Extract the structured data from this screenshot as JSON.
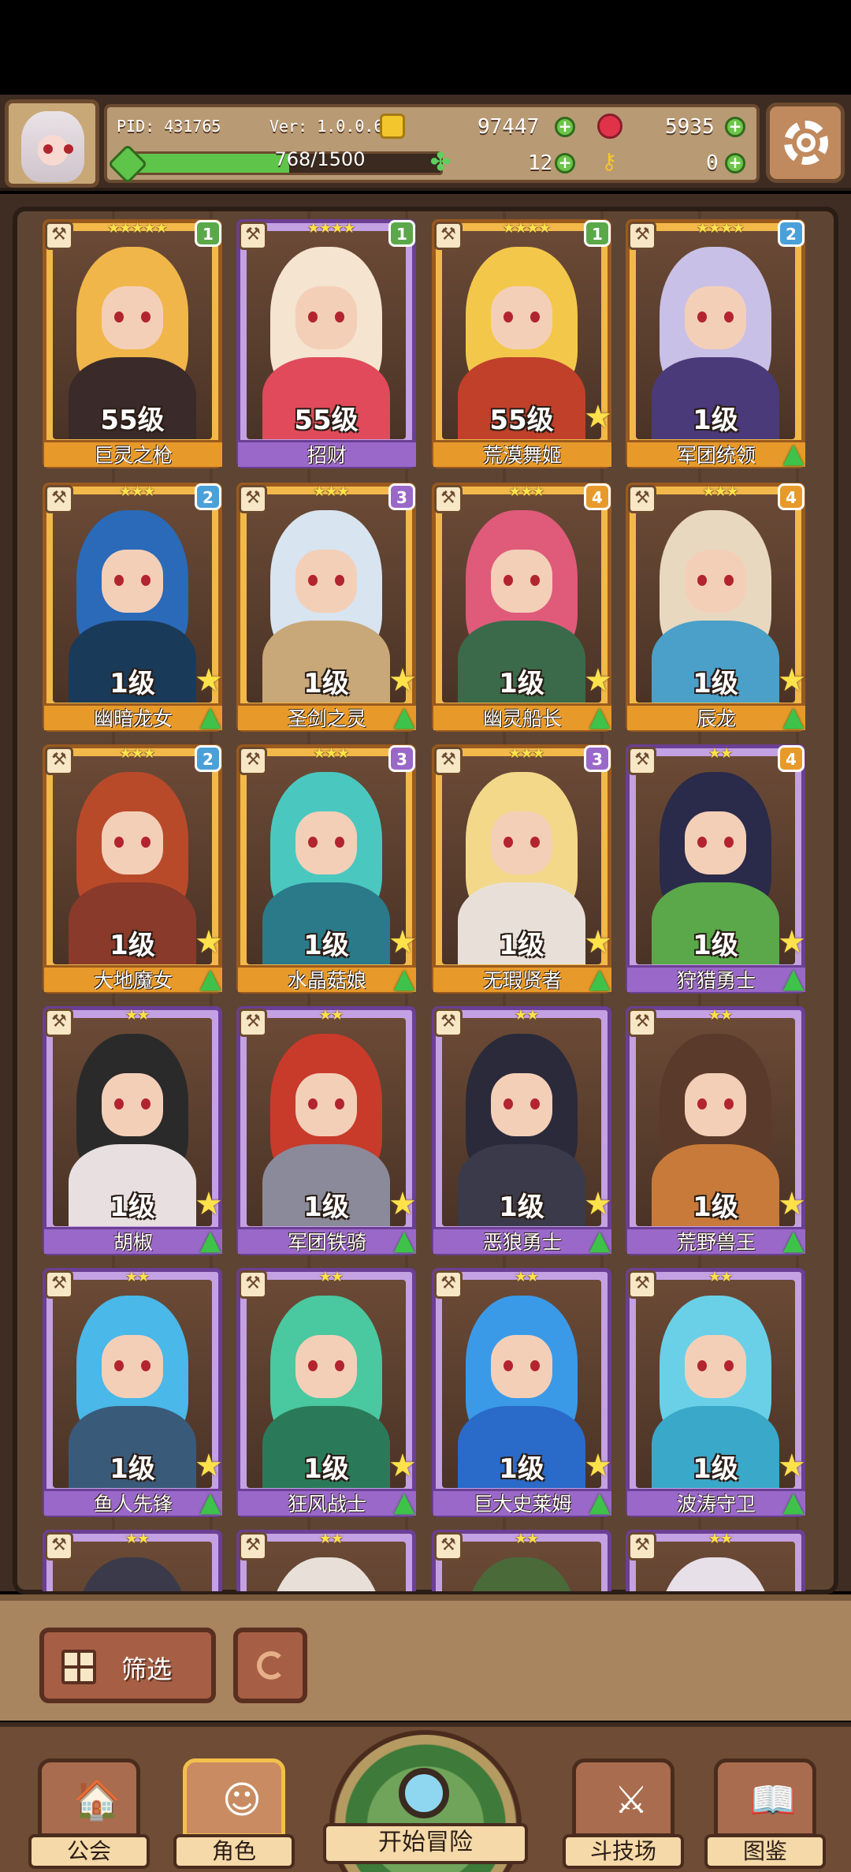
{
  "hud": {
    "pid": "PID: 431765",
    "version": "Ver: 1.0.0.6",
    "coins": "97447",
    "gems": "5935",
    "clovers": "12",
    "keys": "0",
    "xp_text": "768/1500",
    "xp_progress": 0.512
  },
  "cards": [
    {
      "name": "巨灵之枪",
      "level": "55级",
      "stars": "★★★★★",
      "badge": "1",
      "rarity": "gold",
      "badge_color": "#5aa84a",
      "hair": "#f0b64a",
      "body": "#3a2a2a",
      "star_up": false,
      "arrow_up": false
    },
    {
      "name": "招财",
      "level": "55级",
      "stars": "★★★★",
      "badge": "1",
      "rarity": "purple",
      "badge_color": "#5aa84a",
      "hair": "#f4e4d0",
      "body": "#e04a5a",
      "star_up": false,
      "arrow_up": false
    },
    {
      "name": "荒漠舞姬",
      "level": "55级",
      "stars": "★★★★",
      "badge": "1",
      "rarity": "gold",
      "badge_color": "#5aa84a",
      "hair": "#f3c84a",
      "body": "#c0402a",
      "star_up": true,
      "arrow_up": false
    },
    {
      "name": "军团统领",
      "level": "1级",
      "stars": "★★★★",
      "badge": "2",
      "rarity": "gold",
      "badge_color": "#4aa0d8",
      "hair": "#c8c0e6",
      "body": "#4a3a7a",
      "star_up": false,
      "arrow_up": true
    },
    {
      "name": "幽暗龙女",
      "level": "1级",
      "stars": "★★★",
      "badge": "2",
      "rarity": "gold",
      "badge_color": "#4aa0d8",
      "hair": "#2a6ab8",
      "body": "#1a3a5a",
      "star_up": true,
      "arrow_up": true
    },
    {
      "name": "圣剑之灵",
      "level": "1级",
      "stars": "★★★",
      "badge": "3",
      "rarity": "gold",
      "badge_color": "#9a68c8",
      "hair": "#d8e4f0",
      "body": "#c8a878",
      "star_up": true,
      "arrow_up": true
    },
    {
      "name": "幽灵船长",
      "level": "1级",
      "stars": "★★★",
      "badge": "4",
      "rarity": "gold",
      "badge_color": "#e79a2a",
      "hair": "#e05a7a",
      "body": "#3a6a4a",
      "star_up": true,
      "arrow_up": true
    },
    {
      "name": "辰龙",
      "level": "1级",
      "stars": "★★★",
      "badge": "4",
      "rarity": "gold",
      "badge_color": "#e79a2a",
      "hair": "#e8d8c0",
      "body": "#4aa0c8",
      "star_up": true,
      "arrow_up": true
    },
    {
      "name": "大地魔女",
      "level": "1级",
      "stars": "★★★",
      "badge": "2",
      "rarity": "gold",
      "badge_color": "#4aa0d8",
      "hair": "#b84a2a",
      "body": "#8a3a2a",
      "star_up": true,
      "arrow_up": true
    },
    {
      "name": "水晶菇娘",
      "level": "1级",
      "stars": "★★★",
      "badge": "3",
      "rarity": "gold",
      "badge_color": "#9a68c8",
      "hair": "#4ac8c0",
      "body": "#2a7a8a",
      "star_up": true,
      "arrow_up": true
    },
    {
      "name": "无瑕贤者",
      "level": "1级",
      "stars": "★★★",
      "badge": "3",
      "rarity": "gold",
      "badge_color": "#9a68c8",
      "hair": "#f4d88a",
      "body": "#e8e0d8",
      "star_up": true,
      "arrow_up": true
    },
    {
      "name": "狩猎勇士",
      "level": "1级",
      "stars": "★★",
      "badge": "4",
      "rarity": "purple",
      "badge_color": "#e79a2a",
      "hair": "#2a2a4a",
      "body": "#5aa84a",
      "star_up": true,
      "arrow_up": true
    },
    {
      "name": "胡椒",
      "level": "1级",
      "stars": "★★",
      "badge": "",
      "rarity": "purple",
      "badge_color": "",
      "hair": "#2a2a2a",
      "body": "#e8e0e0",
      "star_up": true,
      "arrow_up": true
    },
    {
      "name": "军团铁骑",
      "level": "1级",
      "stars": "★★",
      "badge": "",
      "rarity": "purple",
      "badge_color": "",
      "hair": "#c83a2a",
      "body": "#8a8a9a",
      "star_up": true,
      "arrow_up": true
    },
    {
      "name": "恶狼勇士",
      "level": "1级",
      "stars": "★★",
      "badge": "",
      "rarity": "purple",
      "badge_color": "",
      "hair": "#2a2a3a",
      "body": "#3a3a4a",
      "star_up": true,
      "arrow_up": true
    },
    {
      "name": "荒野兽王",
      "level": "1级",
      "stars": "★★",
      "badge": "",
      "rarity": "purple",
      "badge_color": "",
      "hair": "#5a3a2a",
      "body": "#c87a3a",
      "star_up": true,
      "arrow_up": true
    },
    {
      "name": "鱼人先锋",
      "level": "1级",
      "stars": "★★",
      "badge": "",
      "rarity": "purple",
      "badge_color": "",
      "hair": "#4ab8e8",
      "body": "#3a5a7a",
      "star_up": true,
      "arrow_up": true
    },
    {
      "name": "狂风战士",
      "level": "1级",
      "stars": "★★",
      "badge": "",
      "rarity": "purple",
      "badge_color": "",
      "hair": "#4ac8a0",
      "body": "#2a7a5a",
      "star_up": true,
      "arrow_up": true
    },
    {
      "name": "巨大史莱姆",
      "level": "1级",
      "stars": "★★",
      "badge": "",
      "rarity": "purple",
      "badge_color": "",
      "hair": "#3a9ae8",
      "body": "#2a6ac8",
      "star_up": true,
      "arrow_up": true
    },
    {
      "name": "波涛守卫",
      "level": "1级",
      "stars": "★★",
      "badge": "",
      "rarity": "purple",
      "badge_color": "",
      "hair": "#6ad0e8",
      "body": "#3aa8c8",
      "star_up": true,
      "arrow_up": true
    },
    {
      "name": "",
      "level": "",
      "stars": "★★",
      "badge": "",
      "rarity": "purple",
      "badge_color": "",
      "hair": "#3a3a4a",
      "body": "#3a3a4a",
      "star_up": false,
      "arrow_up": false
    },
    {
      "name": "",
      "level": "",
      "stars": "★★",
      "badge": "",
      "rarity": "purple",
      "badge_color": "",
      "hair": "#e8e0d8",
      "body": "#e8e0d8",
      "star_up": false,
      "arrow_up": false
    },
    {
      "name": "",
      "level": "",
      "stars": "★★",
      "badge": "",
      "rarity": "purple",
      "badge_color": "",
      "hair": "#4a6a3a",
      "body": "#4a6a3a",
      "star_up": false,
      "arrow_up": false
    },
    {
      "name": "",
      "level": "",
      "stars": "★★",
      "badge": "",
      "rarity": "purple",
      "badge_color": "",
      "hair": "#e8e0e8",
      "body": "#e8e0e8",
      "star_up": false,
      "arrow_up": false
    }
  ],
  "filter": {
    "label": "筛选"
  },
  "nav": {
    "guild": "公会",
    "character": "角色",
    "adventure": "开始冒险",
    "arena": "斗技场",
    "codex": "图鉴"
  }
}
